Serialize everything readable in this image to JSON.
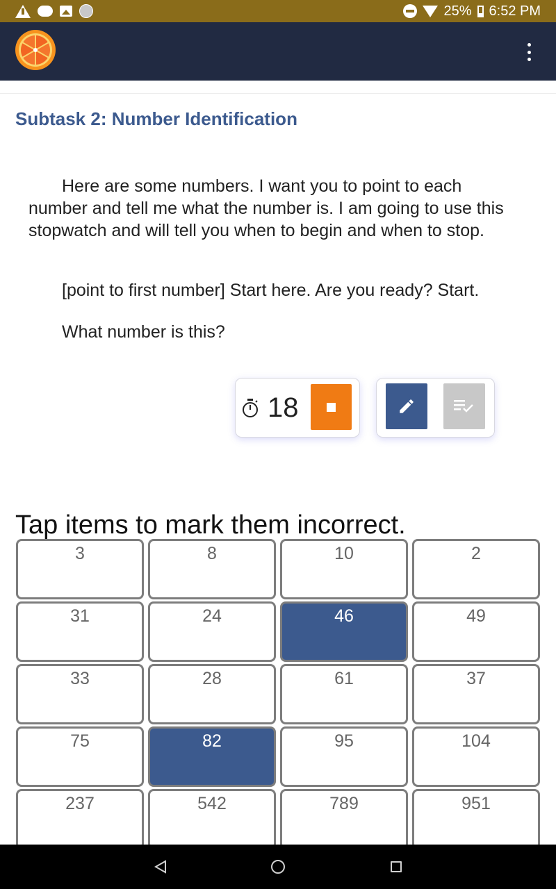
{
  "status_bar": {
    "battery_percent": "25%",
    "time": "6:52 PM"
  },
  "header": {
    "logo_icon": "orange-slice-logo",
    "menu_icon": "more-vert-icon"
  },
  "subtask": {
    "title": "Subtask 2: Number Identification",
    "instructions": "Here are some numbers. I want you to point to each number and tell me what the number is. I am going to use this stopwatch and will tell you when to begin and when to stop.",
    "prompt_start": "[point to first number] Start here.  Are you ready? Start.",
    "prompt_question": "What number is this?"
  },
  "timer": {
    "seconds": "18",
    "stop_color": "#f07b14"
  },
  "tools": {
    "edit_color": "#3c5a8e",
    "review_color": "#c8c8c8"
  },
  "grid": {
    "instruction": "Tap items to mark them incorrect.",
    "items": [
      {
        "label": "3",
        "marked": false
      },
      {
        "label": "8",
        "marked": false
      },
      {
        "label": "10",
        "marked": false
      },
      {
        "label": "2",
        "marked": false
      },
      {
        "label": "31",
        "marked": false
      },
      {
        "label": "24",
        "marked": false
      },
      {
        "label": "46",
        "marked": true
      },
      {
        "label": "49",
        "marked": false
      },
      {
        "label": "33",
        "marked": false
      },
      {
        "label": "28",
        "marked": false
      },
      {
        "label": "61",
        "marked": false
      },
      {
        "label": "37",
        "marked": false
      },
      {
        "label": "75",
        "marked": false
      },
      {
        "label": "82",
        "marked": true
      },
      {
        "label": "95",
        "marked": false
      },
      {
        "label": "104",
        "marked": false
      },
      {
        "label": "237",
        "marked": false
      },
      {
        "label": "542",
        "marked": false
      },
      {
        "label": "789",
        "marked": false
      },
      {
        "label": "951",
        "marked": false
      }
    ]
  }
}
